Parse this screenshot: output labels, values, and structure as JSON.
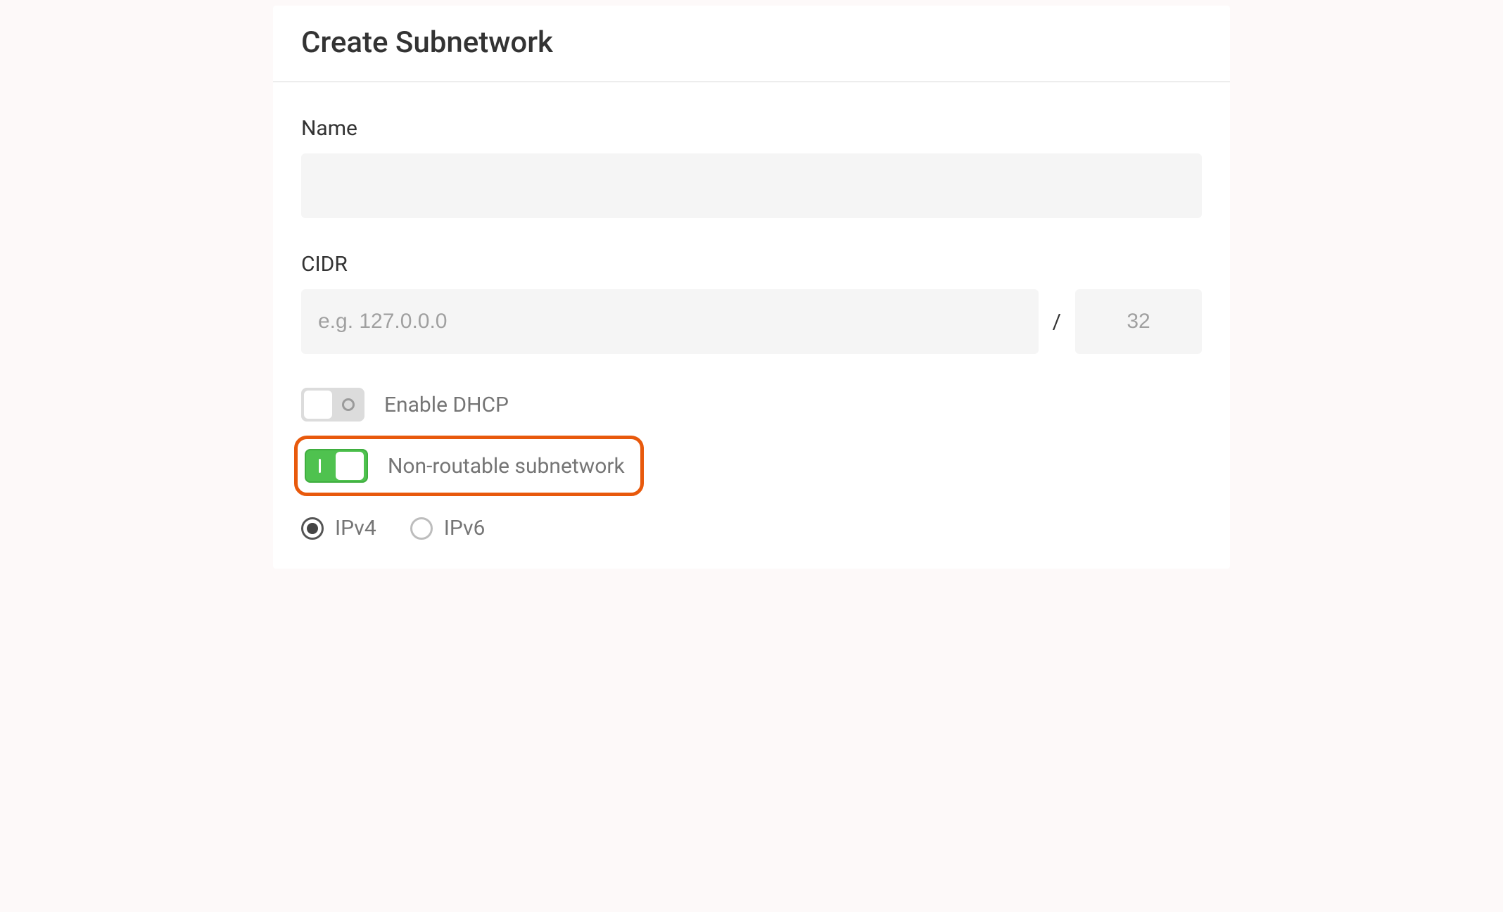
{
  "header": {
    "title": "Create Subnetwork"
  },
  "form": {
    "name": {
      "label": "Name",
      "value": ""
    },
    "cidr": {
      "label": "CIDR",
      "ip_placeholder": "e.g. 127.0.0.0",
      "ip_value": "",
      "slash": "/",
      "prefix_value": "32"
    },
    "dhcp": {
      "label": "Enable DHCP",
      "enabled": false
    },
    "non_routable": {
      "label": "Non-routable subnetwork",
      "enabled": true
    },
    "ip_version": {
      "options": [
        {
          "label": "IPv4",
          "selected": true
        },
        {
          "label": "IPv6",
          "selected": false
        }
      ]
    }
  }
}
